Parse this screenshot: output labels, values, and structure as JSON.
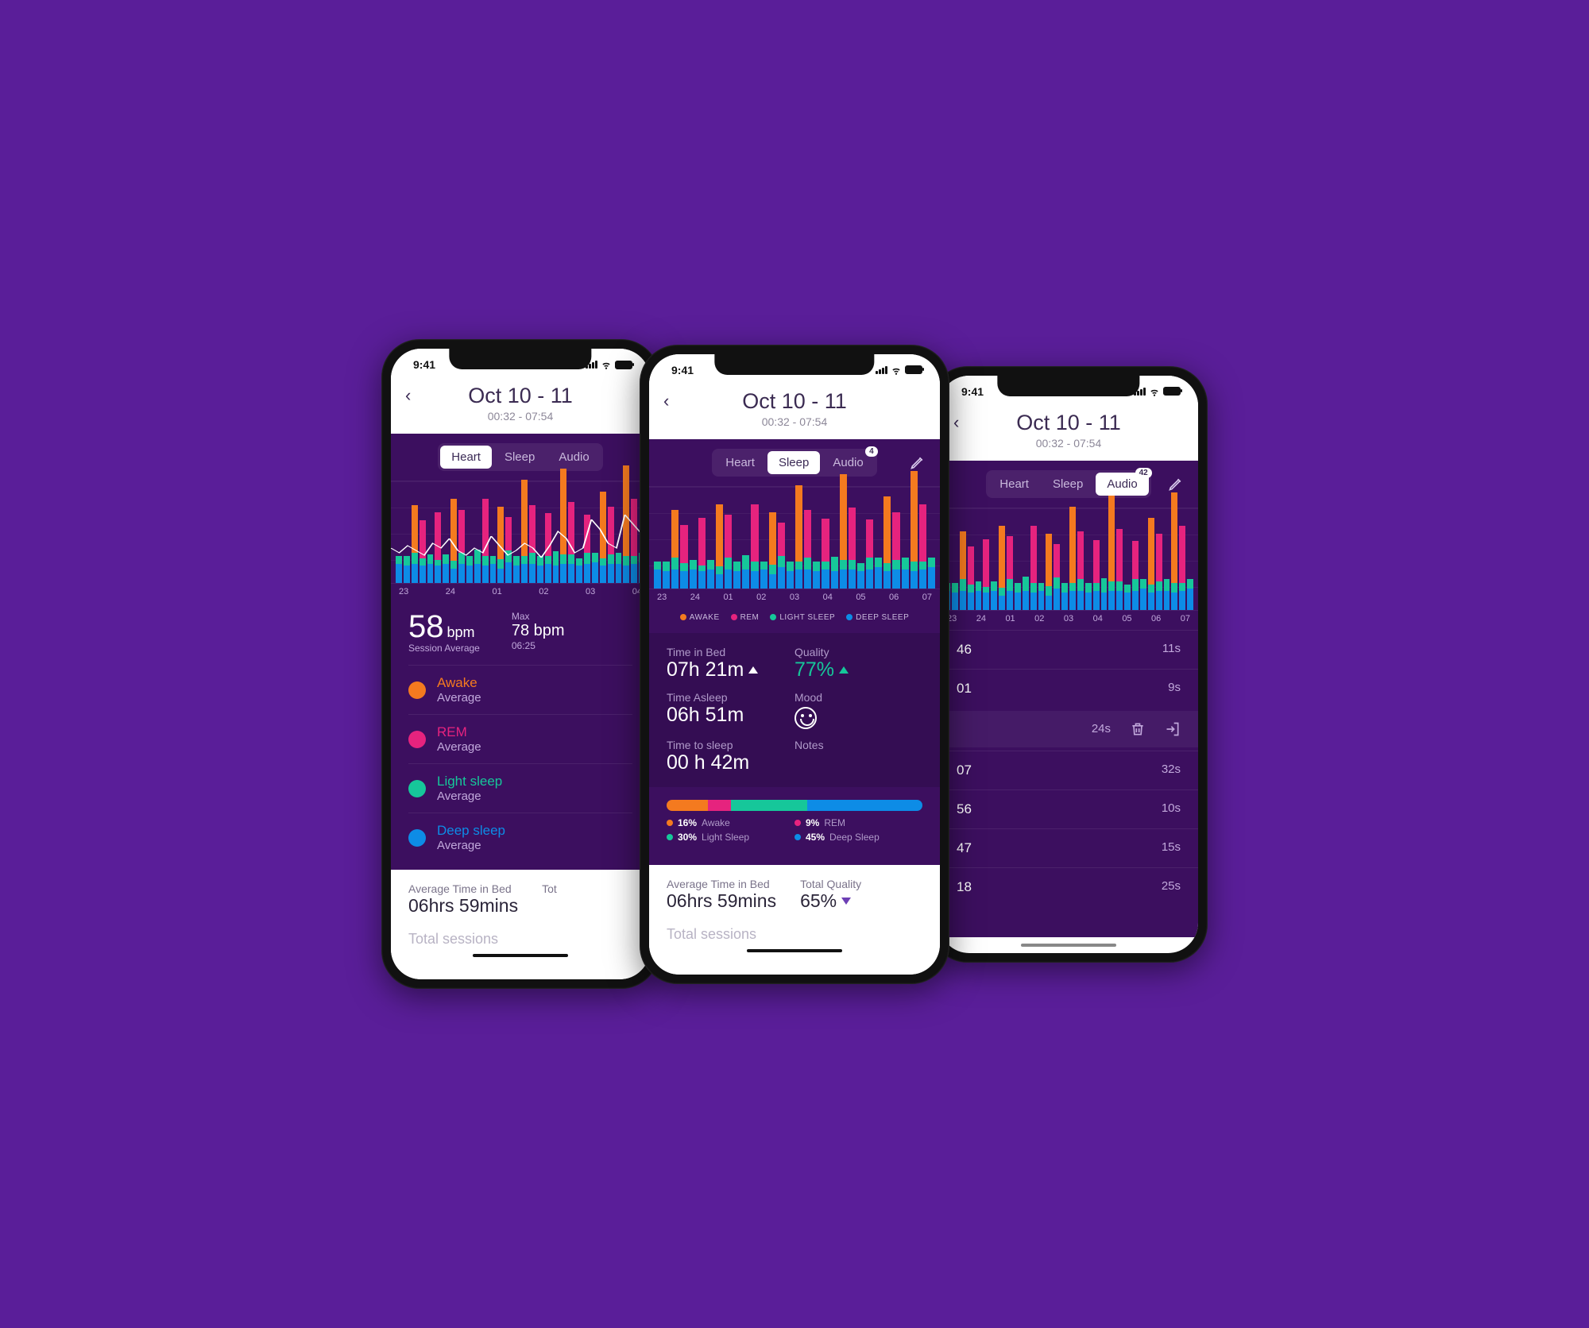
{
  "statusbar": {
    "time": "9:41"
  },
  "header": {
    "title": "Oct 10 - 11",
    "subtitle": "00:32 - 07:54"
  },
  "tabs": {
    "heart": "Heart",
    "sleep": "Sleep",
    "audio": "Audio",
    "sleep_badge": "4",
    "audio_badge": "42"
  },
  "axis": [
    "23",
    "24",
    "01",
    "02",
    "03",
    "04",
    "05",
    "06",
    "07"
  ],
  "sleep_legend": {
    "awake": "AWAKE",
    "rem": "REM",
    "light": "LIGHT SLEEP",
    "deep": "DEEP SLEEP"
  },
  "colors": {
    "awake": "#f47a1f",
    "rem": "#e6237e",
    "light": "#16c79a",
    "deep": "#0d8ce6",
    "accent_teal": "#16c79a"
  },
  "heart": {
    "avg_value": "58",
    "avg_unit": "bpm",
    "avg_label": "Session Average",
    "max_label": "Max",
    "max_value": "78 bpm",
    "max_time": "06:25",
    "stages": [
      {
        "name": "Awake",
        "sub": "Average",
        "color": "#f47a1f"
      },
      {
        "name": "REM",
        "sub": "Average",
        "color": "#e6237e"
      },
      {
        "name": "Light sleep",
        "sub": "Average",
        "color": "#16c79a"
      },
      {
        "name": "Deep sleep",
        "sub": "Average",
        "color": "#0d8ce6"
      }
    ]
  },
  "sleep": {
    "time_in_bed": {
      "label": "Time in Bed",
      "value": "07h 21m"
    },
    "quality": {
      "label": "Quality",
      "value": "77%"
    },
    "time_asleep": {
      "label": "Time Asleep",
      "value": "06h 51m"
    },
    "mood": {
      "label": "Mood"
    },
    "time_to_sleep": {
      "label": "Time to sleep",
      "value": "00 h 42m"
    },
    "notes": {
      "label": "Notes"
    },
    "breakdown": [
      {
        "pct": "16%",
        "label": "Awake",
        "color": "#f47a1f",
        "w": 16
      },
      {
        "pct": "9%",
        "label": "REM",
        "color": "#e6237e",
        "w": 9
      },
      {
        "pct": "30%",
        "label": "Light Sleep",
        "color": "#16c79a",
        "w": 30
      },
      {
        "pct": "45%",
        "label": "Deep Sleep",
        "color": "#0d8ce6",
        "w": 45
      }
    ]
  },
  "audio": {
    "rows": [
      {
        "time": "46",
        "dur": "11s"
      },
      {
        "time": "01",
        "dur": "9s"
      }
    ],
    "action_dur": "24s",
    "more": [
      {
        "time": "07",
        "dur": "32s"
      },
      {
        "time": "56",
        "dur": "10s"
      },
      {
        "time": "47",
        "dur": "15s"
      },
      {
        "time": "18",
        "dur": "25s"
      }
    ]
  },
  "footer": {
    "avg_label": "Average Time in Bed",
    "avg_value": "06hrs 59mins",
    "total_label_short": "Tot",
    "total_label": "Total Quality",
    "total_value": "65%",
    "sessions": "Total sessions"
  },
  "chart_data": {
    "type": "bar",
    "stacked": true,
    "x_ticks": [
      "23",
      "24",
      "01",
      "02",
      "03",
      "04",
      "05",
      "06",
      "07"
    ],
    "series_colors": {
      "awake": "#f47a1f",
      "rem": "#e6237e",
      "light": "#16c79a",
      "deep": "#0d8ce6"
    },
    "note": "Stacked sleep-stage intensity bars with heart-rate line overlay (left phone). Heights are approximate proportions read from screenshot on 0–1 scale.",
    "bars": [
      {
        "deep": 0.2,
        "light": 0.08,
        "rem": 0.0,
        "awake": 0.0
      },
      {
        "deep": 0.18,
        "light": 0.1,
        "rem": 0.0,
        "awake": 0.0
      },
      {
        "deep": 0.2,
        "light": 0.12,
        "rem": 0.0,
        "awake": 0.5
      },
      {
        "deep": 0.18,
        "light": 0.08,
        "rem": 0.4,
        "awake": 0.0
      },
      {
        "deep": 0.2,
        "light": 0.1,
        "rem": 0.0,
        "awake": 0.0
      },
      {
        "deep": 0.18,
        "light": 0.06,
        "rem": 0.5,
        "awake": 0.0
      },
      {
        "deep": 0.2,
        "light": 0.1,
        "rem": 0.0,
        "awake": 0.0
      },
      {
        "deep": 0.15,
        "light": 0.08,
        "rem": 0.0,
        "awake": 0.65
      },
      {
        "deep": 0.2,
        "light": 0.12,
        "rem": 0.45,
        "awake": 0.0
      },
      {
        "deep": 0.18,
        "light": 0.1,
        "rem": 0.0,
        "awake": 0.0
      },
      {
        "deep": 0.2,
        "light": 0.15,
        "rem": 0.0,
        "awake": 0.0
      },
      {
        "deep": 0.18,
        "light": 0.1,
        "rem": 0.6,
        "awake": 0.0
      },
      {
        "deep": 0.2,
        "light": 0.08,
        "rem": 0.0,
        "awake": 0.0
      },
      {
        "deep": 0.15,
        "light": 0.1,
        "rem": 0.0,
        "awake": 0.55
      },
      {
        "deep": 0.22,
        "light": 0.12,
        "rem": 0.35,
        "awake": 0.0
      },
      {
        "deep": 0.18,
        "light": 0.1,
        "rem": 0.0,
        "awake": 0.0
      },
      {
        "deep": 0.2,
        "light": 0.08,
        "rem": 0.0,
        "awake": 0.8
      },
      {
        "deep": 0.2,
        "light": 0.12,
        "rem": 0.5,
        "awake": 0.0
      },
      {
        "deep": 0.18,
        "light": 0.1,
        "rem": 0.0,
        "awake": 0.0
      },
      {
        "deep": 0.2,
        "light": 0.08,
        "rem": 0.45,
        "awake": 0.0
      },
      {
        "deep": 0.18,
        "light": 0.15,
        "rem": 0.0,
        "awake": 0.0
      },
      {
        "deep": 0.2,
        "light": 0.1,
        "rem": 0.0,
        "awake": 0.9
      },
      {
        "deep": 0.2,
        "light": 0.1,
        "rem": 0.55,
        "awake": 0.0
      },
      {
        "deep": 0.18,
        "light": 0.08,
        "rem": 0.0,
        "awake": 0.0
      },
      {
        "deep": 0.2,
        "light": 0.12,
        "rem": 0.4,
        "awake": 0.0
      },
      {
        "deep": 0.22,
        "light": 0.1,
        "rem": 0.0,
        "awake": 0.0
      },
      {
        "deep": 0.18,
        "light": 0.08,
        "rem": 0.0,
        "awake": 0.7
      },
      {
        "deep": 0.2,
        "light": 0.1,
        "rem": 0.5,
        "awake": 0.0
      },
      {
        "deep": 0.2,
        "light": 0.12,
        "rem": 0.0,
        "awake": 0.0
      },
      {
        "deep": 0.18,
        "light": 0.1,
        "rem": 0.0,
        "awake": 0.95
      },
      {
        "deep": 0.2,
        "light": 0.08,
        "rem": 0.6,
        "awake": 0.0
      },
      {
        "deep": 0.22,
        "light": 0.1,
        "rem": 0.0,
        "awake": 0.0
      }
    ],
    "heart_rate_line": [
      58,
      56,
      59,
      57,
      55,
      60,
      58,
      62,
      57,
      55,
      58,
      56,
      63,
      59,
      55,
      57,
      60,
      58,
      54,
      59,
      65,
      62,
      56,
      58,
      70,
      66,
      60,
      58,
      72,
      68,
      64,
      60
    ]
  }
}
